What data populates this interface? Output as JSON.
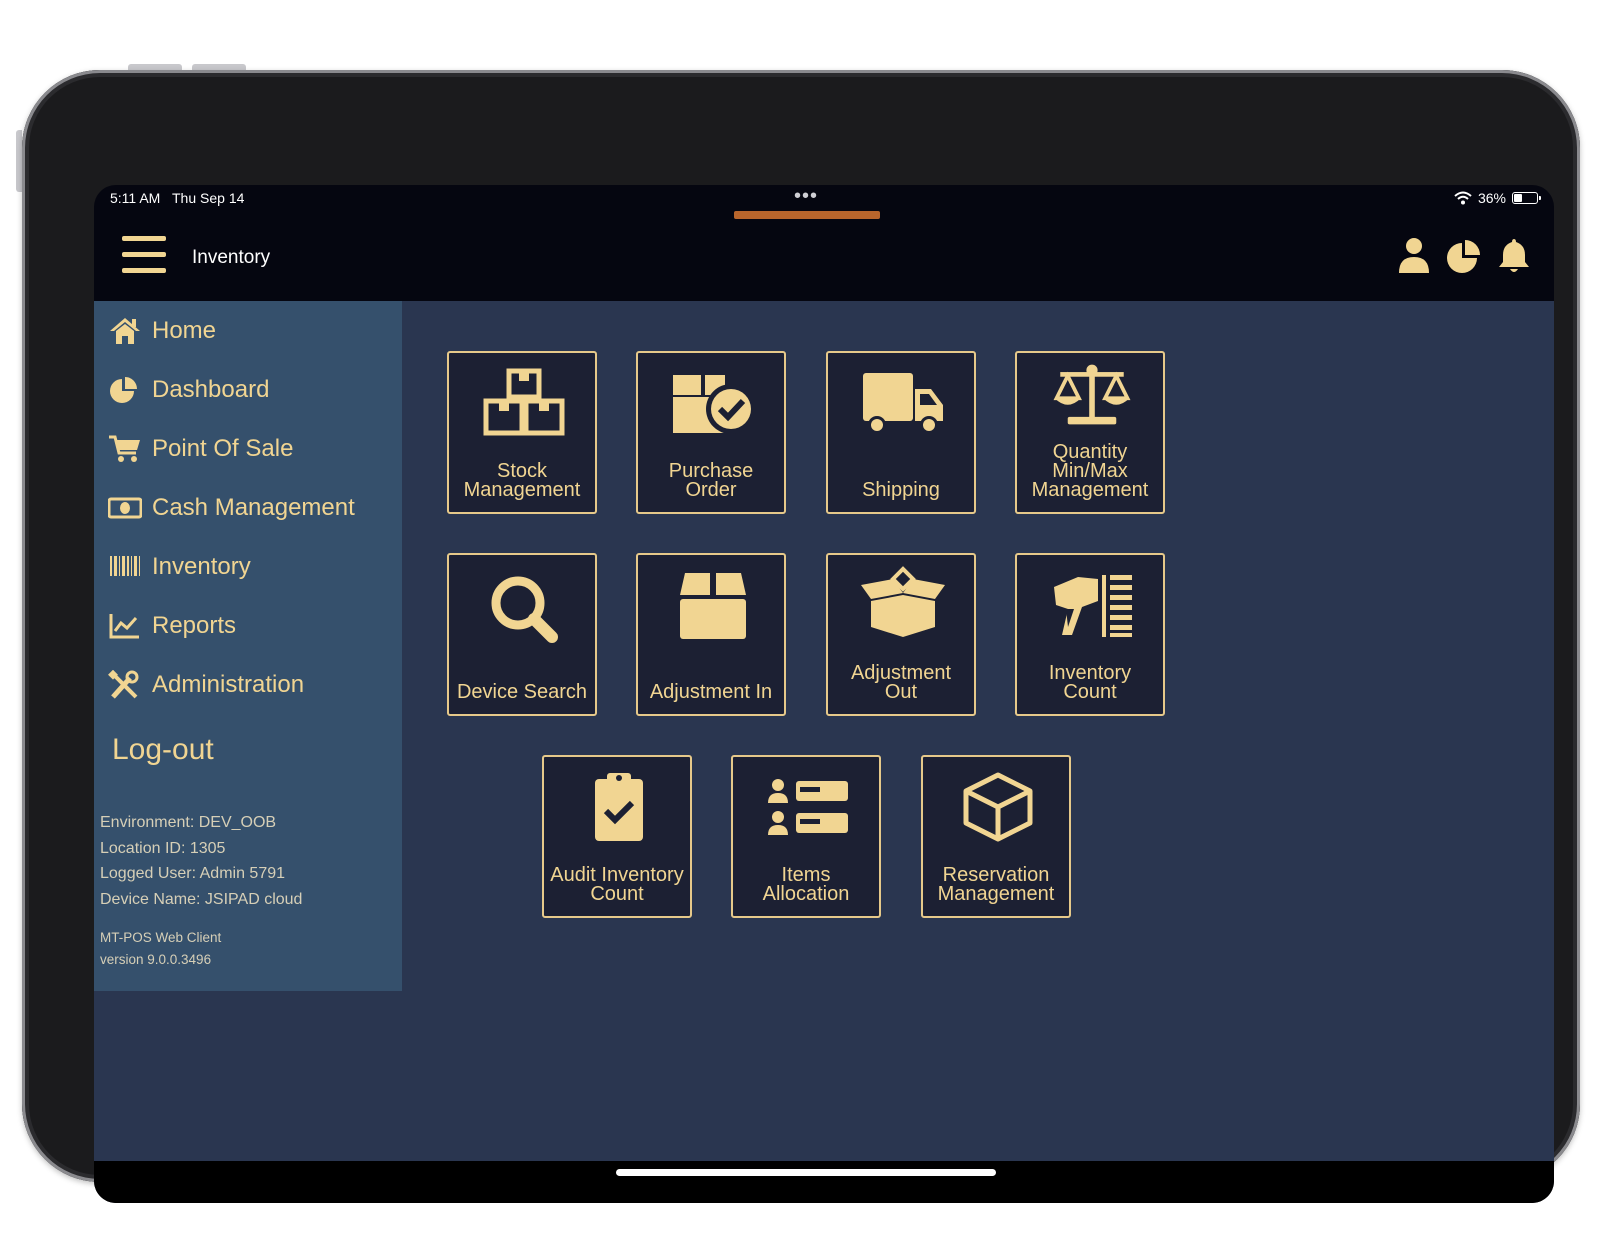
{
  "status_bar": {
    "time": "5:11 AM",
    "date": "Thu Sep 14",
    "dots": "•••",
    "battery_percent": "36%",
    "battery_level": 0.36
  },
  "header": {
    "title": "Inventory"
  },
  "sidebar": {
    "items": [
      {
        "label": "Home",
        "icon": "home-icon"
      },
      {
        "label": "Dashboard",
        "icon": "pie-chart-icon"
      },
      {
        "label": "Point Of Sale",
        "icon": "cart-icon"
      },
      {
        "label": "Cash Management",
        "icon": "cash-icon"
      },
      {
        "label": "Inventory",
        "icon": "barcode-icon"
      },
      {
        "label": "Reports",
        "icon": "line-chart-icon"
      },
      {
        "label": "Administration",
        "icon": "tools-icon"
      }
    ],
    "logout": "Log-out",
    "info": {
      "environment": "Environment: DEV_OOB",
      "location": "Location ID: 1305",
      "user": "Logged User: Admin 5791",
      "device": "Device Name: JSIPAD cloud"
    },
    "version": {
      "line1": "MT-POS Web Client",
      "line2": "version 9.0.0.3496"
    }
  },
  "tiles": [
    {
      "line1": "Stock",
      "line2": "Management",
      "line3": "",
      "icon": "boxes-icon"
    },
    {
      "line1": "Purchase",
      "line2": "Order",
      "line3": "",
      "icon": "purchase-order-icon"
    },
    {
      "line1": "Shipping",
      "line2": "",
      "line3": "",
      "icon": "truck-icon"
    },
    {
      "line1": "Quantity",
      "line2": "Min/Max",
      "line3": "Management",
      "icon": "scale-icon"
    },
    {
      "line1": "Device Search",
      "line2": "",
      "line3": "",
      "icon": "search-icon"
    },
    {
      "line1": "Adjustment In",
      "line2": "",
      "line3": "",
      "icon": "box-icon"
    },
    {
      "line1": "Adjustment",
      "line2": "Out",
      "line3": "",
      "icon": "open-box-icon"
    },
    {
      "line1": "Inventory",
      "line2": "Count",
      "line3": "",
      "icon": "scanner-icon"
    },
    {
      "line1": "Audit Inventory",
      "line2": "Count",
      "line3": "",
      "icon": "clipboard-check-icon"
    },
    {
      "line1": "Items",
      "line2": "Allocation",
      "line3": "",
      "icon": "user-list-icon"
    },
    {
      "line1": "Reservation",
      "line2": "Management",
      "line3": "",
      "icon": "cube-icon"
    }
  ],
  "colors": {
    "accent": "#f1d592",
    "sidebar_bg": "#35506c",
    "content_bg": "#2a3650",
    "tile_bg": "#1c2033",
    "tile_border": "#e6c98a",
    "header_bg": "#050610",
    "handle": "#b8652c"
  }
}
